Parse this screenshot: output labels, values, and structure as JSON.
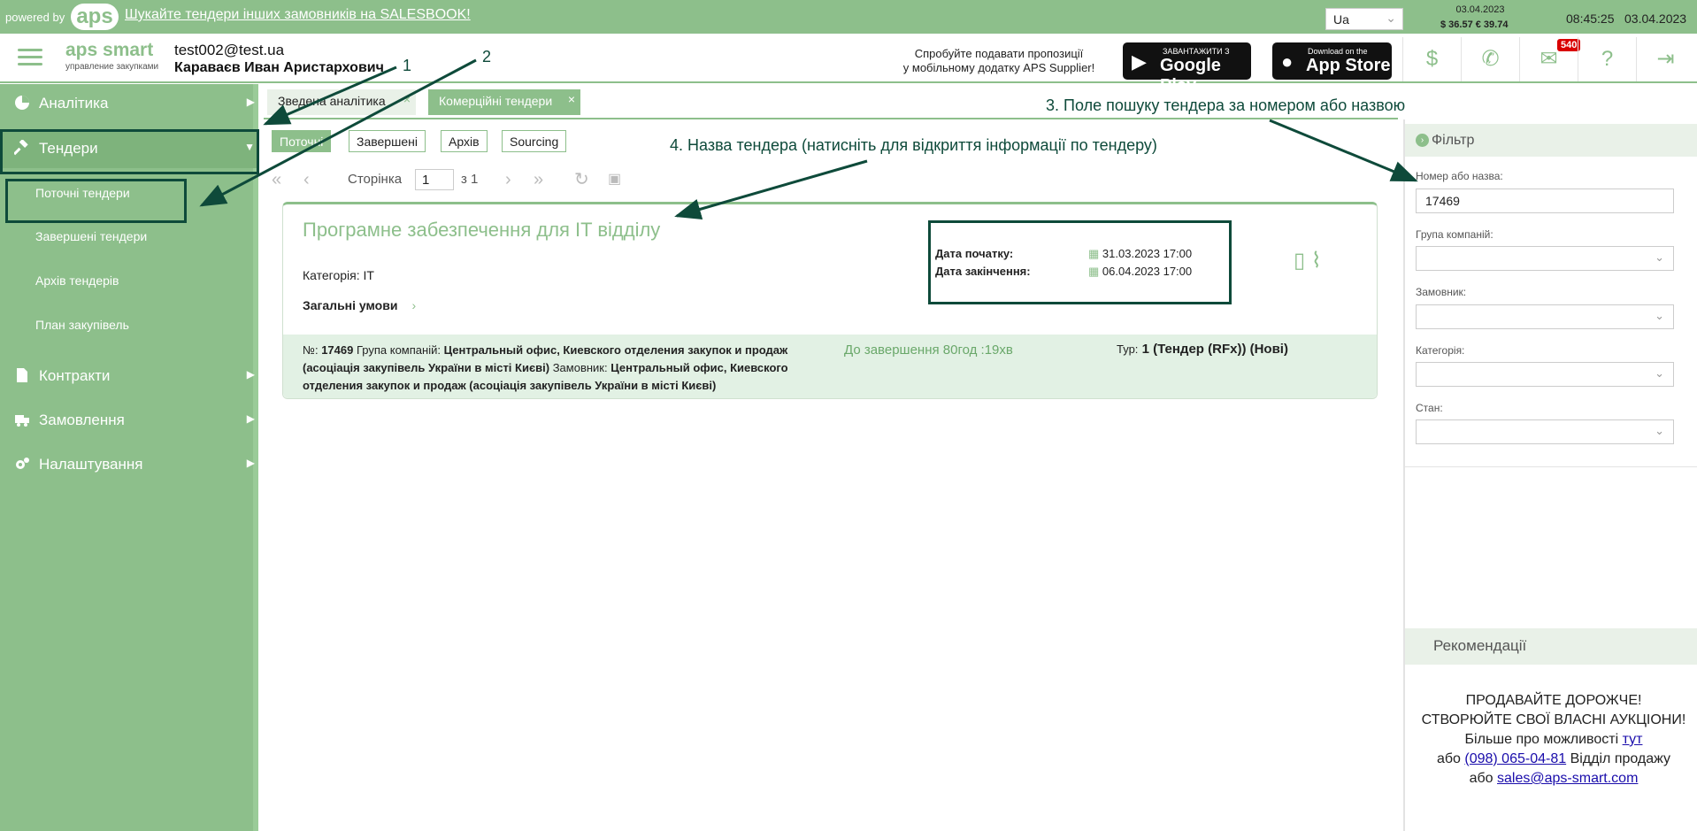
{
  "topbar": {
    "powered_by": "powered by",
    "logo": "aps",
    "salesbook_link": "Шукайте тендери інших замовників на SALESBOOK!",
    "language": "Ua",
    "rates_date": "03.04.2023",
    "rates": "$ 36.57  € 39.74",
    "time": "08:45:25",
    "date": "03.04.2023"
  },
  "header": {
    "brand": "aps smart",
    "brand_sub": "управление закупками",
    "user_email": "test002@test.ua",
    "user_name": "Караваєв Иван Аристархович",
    "promo_line1": "Спробуйте подавати пропозиції",
    "promo_line2": "у мобільному додатку APS Supplier!",
    "google_play_small": "ЗАВАНТАЖИТИ З",
    "google_play_big": "Google Play",
    "app_store_small": "Download on the",
    "app_store_big": "App Store",
    "messages_badge": "540",
    "icons": [
      "dollar-icon",
      "phone-icon",
      "mail-icon",
      "help-icon",
      "logout-icon"
    ]
  },
  "sidebar": {
    "items": [
      {
        "label": "Аналітика",
        "icon": "pie-chart-icon"
      },
      {
        "label": "Тендери",
        "icon": "gavel-icon"
      },
      {
        "label": "Контракти",
        "icon": "document-icon"
      },
      {
        "label": "Замовлення",
        "icon": "truck-icon"
      },
      {
        "label": "Налаштування",
        "icon": "gears-icon"
      }
    ],
    "subitems": [
      {
        "label": "Поточні тендери"
      },
      {
        "label": "Завершені тендери"
      },
      {
        "label": "Архів тендерів"
      },
      {
        "label": "План закупівель"
      }
    ]
  },
  "tabs": [
    {
      "label": "Зведена аналітика"
    },
    {
      "label": "Комерційні тендери"
    }
  ],
  "chips": [
    "Поточні",
    "Завершені",
    "Архів",
    "Sourcing"
  ],
  "pager": {
    "page_label": "Сторінка",
    "page": "1",
    "of": "з 1"
  },
  "tender": {
    "title": "Програмне забезпечення для IT відділу",
    "category_label": "Категорія:",
    "category": "IT",
    "terms": "Загальні умови",
    "start_label": "Дата початку:",
    "start": "31.03.2023 17:00",
    "end_label": "Дата закінчення:",
    "end": "06.04.2023 17:00",
    "number_label": "№:",
    "number": "17469",
    "group_label": "Група компаній:",
    "group": "Центральный офис, Киевского отделения закупок и продаж (асоціація закупівель України в місті Києві)",
    "customer_label": "Замовник:",
    "customer": "Центральный офис, Киевского отделения закупок и продаж (асоціація закупівель України в місті Києві)",
    "remaining": "До завершення 80год :19хв",
    "tour_label": "Тур:",
    "tour": "1 (Тендер (RFx)) (Нові)"
  },
  "filter": {
    "title": "Фільтр",
    "number_label": "Номер або назва:",
    "number_value": "17469",
    "group_label": "Група компаній:",
    "customer_label": "Замовник:",
    "category_label": "Категорія:",
    "state_label": "Стан:"
  },
  "recommendations": {
    "title": "Рекомендації",
    "line1": "ПРОДАВАЙТЕ ДОРОЖЧЕ!",
    "line2": "СТВОРЮЙТЕ СВОЇ ВЛАСНІ АУКЦІОНИ!",
    "line3": "Більше про можливості",
    "link_here": "тут",
    "or1": "або",
    "phone": "(098) 065-04-81",
    "sales_dept": "Відділ продажу",
    "or2": "або",
    "email": "sales@aps-smart.com"
  },
  "annotations": {
    "a1": "1",
    "a2": "2",
    "a3": "3. Поле пошуку тендера за номером або назвою",
    "a4": "4. Назва тендера (натисніть для відкриття інформації по тендеру)"
  },
  "colors": {
    "accent": "#8dbf8b",
    "annotation": "#0e4a3a",
    "badge": "#d90000"
  }
}
